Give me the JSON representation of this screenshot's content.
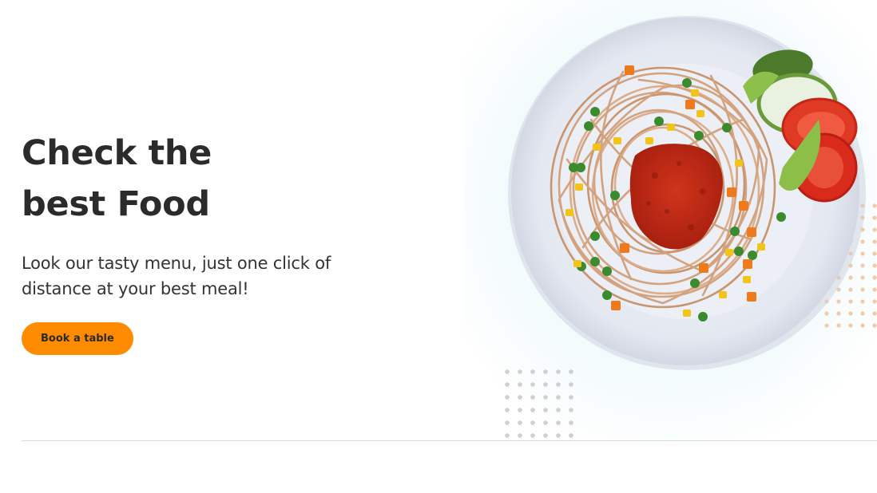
{
  "hero": {
    "title_line1": "Check the",
    "title_line2": "best Food",
    "subtitle_line1": "Look our tasty menu, just one click of",
    "subtitle_line2": "distance at your best meal!",
    "button_label": "Book a table"
  },
  "colors": {
    "accent": "#ff8c00",
    "text": "#2b2b2b",
    "divider": "#d9d9d9",
    "dots_gray": "#c8c8c8",
    "dots_orange": "#f5c9a0"
  },
  "image": {
    "icon": "spaghetti-plate-image"
  }
}
